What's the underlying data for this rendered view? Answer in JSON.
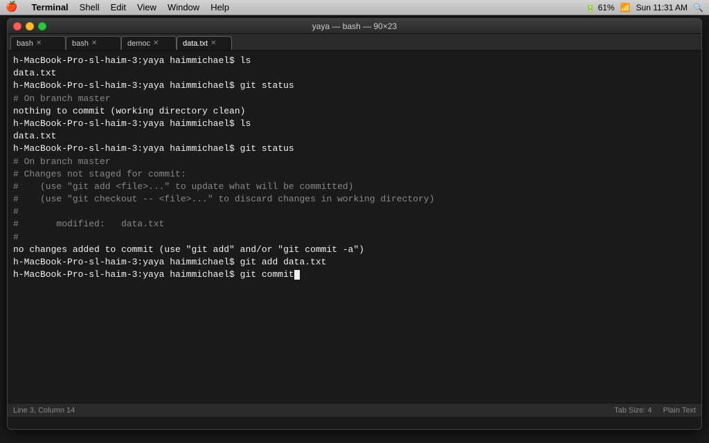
{
  "menubar": {
    "apple": "🍎",
    "items": [
      "Terminal",
      "Shell",
      "Edit",
      "View",
      "Window",
      "Help"
    ],
    "right": {
      "battery_icon": "🔋",
      "wifi": "WiFi",
      "time": "Sun 11:31 AM",
      "battery_percent": "61%"
    }
  },
  "titlebar": {
    "title": "yaya — bash — 90×23"
  },
  "tabs": [
    {
      "label": "bash",
      "active": false
    },
    {
      "label": "bash",
      "active": false
    },
    {
      "label": "democ",
      "active": false
    },
    {
      "label": "data.txt",
      "active": true
    }
  ],
  "terminal": {
    "lines": [
      {
        "type": "prompt",
        "text": "h-MacBook-Pro-sl-haim-3:yaya haimmichael$ ls"
      },
      {
        "type": "output",
        "text": "data.txt"
      },
      {
        "type": "prompt",
        "text": "h-MacBook-Pro-sl-haim-3:yaya haimmichael$ git status"
      },
      {
        "type": "comment",
        "text": "# On branch master"
      },
      {
        "type": "output",
        "text": "nothing to commit (working directory clean)"
      },
      {
        "type": "prompt",
        "text": "h-MacBook-Pro-sl-haim-3:yaya haimmichael$ ls"
      },
      {
        "type": "output",
        "text": "data.txt"
      },
      {
        "type": "prompt",
        "text": "h-MacBook-Pro-sl-haim-3:yaya haimmichael$ git status"
      },
      {
        "type": "comment",
        "text": "# On branch master"
      },
      {
        "type": "comment",
        "text": "# Changes not staged for commit:"
      },
      {
        "type": "comment",
        "text": "#\t(use \"git add <file>...\" to update what will be committed)"
      },
      {
        "type": "comment",
        "text": "#\t(use \"git checkout -- <file>...\" to discard changes in working directory)"
      },
      {
        "type": "comment",
        "text": "#"
      },
      {
        "type": "comment",
        "text": "#\t\tmodified:   data.txt"
      },
      {
        "type": "comment",
        "text": "#"
      },
      {
        "type": "output",
        "text": "no changes added to commit (use \"git add\" and/or \"git commit -a\")"
      },
      {
        "type": "prompt",
        "text": "h-MacBook-Pro-sl-haim-3:yaya haimmichael$ git add data.txt"
      },
      {
        "type": "prompt_cursor",
        "text": "h-MacBook-Pro-sl-haim-3:yaya haimmichael$ git commit"
      }
    ]
  },
  "statusbar": {
    "left": "Line 3, Column 14",
    "right_items": [
      "Tab Size: 4",
      "Plain Text"
    ]
  }
}
